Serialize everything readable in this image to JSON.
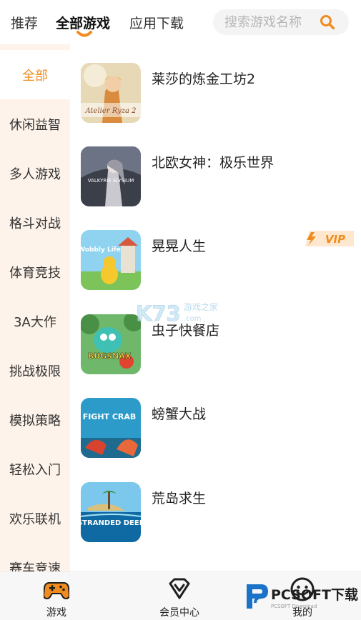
{
  "top_tabs": [
    {
      "label": "推荐"
    },
    {
      "label": "全部游戏"
    },
    {
      "label": "应用下载"
    }
  ],
  "search": {
    "placeholder": "搜索游戏名称"
  },
  "categories": [
    "全部",
    "休闲益智",
    "多人游戏",
    "格斗对战",
    "体育竞技",
    "3A大作",
    "挑战极限",
    "模拟策略",
    "轻松入门",
    "欢乐联机",
    "赛车竞速"
  ],
  "games": [
    {
      "title": "莱莎的炼金工坊2",
      "cover_text": "Atelier Ryza 2"
    },
    {
      "title": "北欧女神：极乐世界",
      "cover_text": "VALKYRIE ELYSIUM"
    },
    {
      "title": "晃晃人生",
      "cover_text": "Wobbly Life",
      "badge": "VIP"
    },
    {
      "title": "虫子快餐店",
      "cover_text": "BUGSNAX"
    },
    {
      "title": "螃蟹大战",
      "cover_text": "FIGHT CRAB"
    },
    {
      "title": "荒岛求生",
      "cover_text": "STRANDED DEEP"
    }
  ],
  "bottom_nav": [
    {
      "label": "游戏",
      "icon": "gamepad-icon"
    },
    {
      "label": "会员中心",
      "icon": "diamond-icon"
    },
    {
      "label": "我的",
      "icon": "smiley-icon"
    }
  ],
  "watermark": {
    "text": "K73",
    "sub": "游戏之家"
  },
  "brand_logo": {
    "text": "PCSOFT下载",
    "sub": "PCSOFT Download"
  },
  "colors": {
    "accent": "#f08c1f",
    "sidebar_bg": "#fdf3ea",
    "vip": "#f5a623"
  }
}
